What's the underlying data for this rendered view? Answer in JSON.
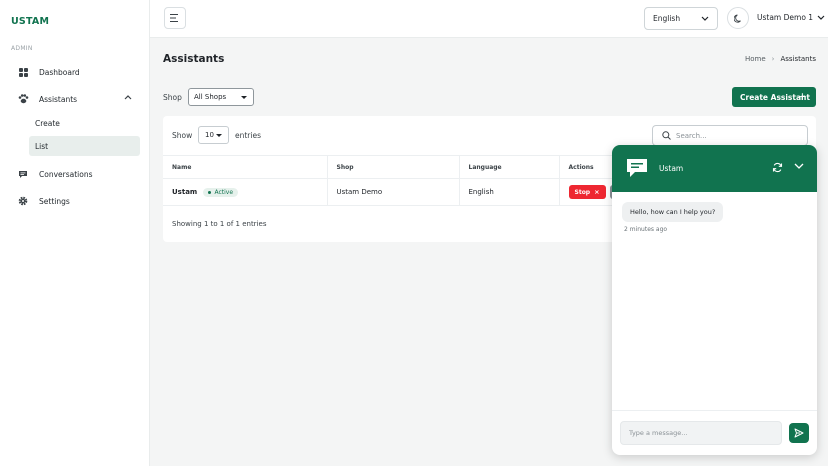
{
  "app": {
    "brand": "USTAM"
  },
  "sidebar": {
    "section_label": "ADMIN",
    "items": [
      {
        "label": "Dashboard",
        "icon": "grid-icon"
      },
      {
        "label": "Assistants",
        "icon": "paw-icon",
        "expanded": true,
        "children": [
          {
            "label": "Create"
          },
          {
            "label": "List",
            "active": true
          }
        ]
      },
      {
        "label": "Conversations",
        "icon": "chat-icon"
      },
      {
        "label": "Settings",
        "icon": "gear-icon"
      }
    ]
  },
  "topbar": {
    "language": "English",
    "user_name": "Ustam Demo 1"
  },
  "page": {
    "title": "Assistants",
    "breadcrumb": {
      "home": "Home",
      "current": "Assistants"
    },
    "shop_filter": {
      "label": "Shop",
      "value": "All Shops"
    },
    "create_button": "Create Assistant"
  },
  "table": {
    "show_label": "Show",
    "entries_value": "10",
    "entries_label": "entries",
    "search_placeholder": "Search...",
    "columns": [
      "Name",
      "Shop",
      "Language",
      "Actions"
    ],
    "rows": [
      {
        "name": "Ustam",
        "status": "Active",
        "shop": "Ustam Demo",
        "language": "English",
        "action": "Stop"
      }
    ],
    "footer": "Showing 1 to 1 of 1 entries"
  },
  "chat": {
    "title": "Ustam",
    "messages": [
      {
        "text": "Hello, how can I help you?",
        "time": "2 minutes ago"
      }
    ],
    "input_placeholder": "Type a message...",
    "accent": "#11734f"
  },
  "colors": {
    "brand": "#11734f",
    "danger": "#ee2731"
  }
}
